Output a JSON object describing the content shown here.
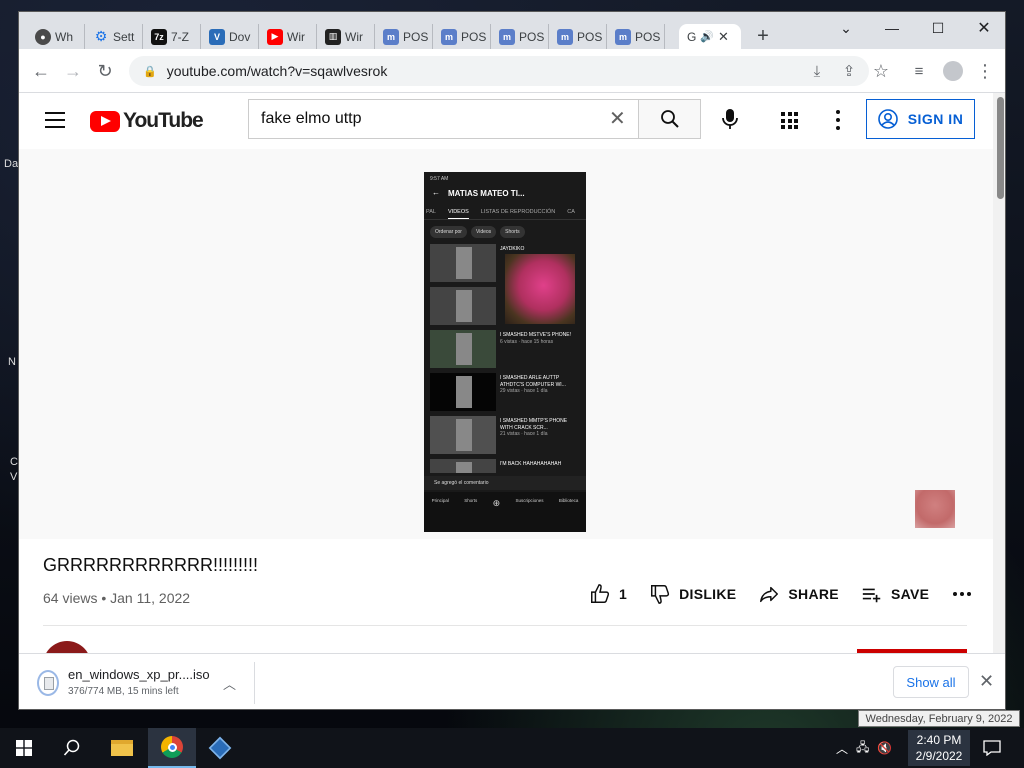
{
  "browser": {
    "tabs": [
      {
        "label": "Wh",
        "icon": "chrome-icon",
        "color": "#4a4a4a"
      },
      {
        "label": "Sett",
        "icon": "gear-icon",
        "color": "#1a73e8"
      },
      {
        "label": "7-Z",
        "icon": "7zip-icon",
        "color": "#111111"
      },
      {
        "label": "Dov",
        "icon": "virtualbox-icon",
        "color": "#2a6cb8"
      },
      {
        "label": "Wir",
        "icon": "youtube-icon",
        "color": "#ff0000"
      },
      {
        "label": "Wir",
        "icon": "archive-icon",
        "color": "#222222"
      },
      {
        "label": "POS",
        "icon": "m-icon",
        "color": "#5b7ec9"
      },
      {
        "label": "POS",
        "icon": "m-icon",
        "color": "#5b7ec9"
      },
      {
        "label": "POS",
        "icon": "m-icon",
        "color": "#5b7ec9"
      },
      {
        "label": "POS",
        "icon": "m-icon",
        "color": "#5b7ec9"
      },
      {
        "label": "POS",
        "icon": "m-icon",
        "color": "#5b7ec9"
      },
      {
        "label": "G",
        "icon": "audio-icon",
        "color": "#202124"
      }
    ],
    "url": "youtube.com/watch?v=sqawlvesrok"
  },
  "youtube": {
    "logo_text": "YouTube",
    "search_value": "fake elmo uttp",
    "sign_in": "SIGN IN",
    "accent": "#ff0000",
    "link_color": "#065fd4"
  },
  "phone": {
    "status_time": "9:57 AM",
    "channel_title": "MATIAS MATEO TI...",
    "tabs": [
      "PAL",
      "VIDEOS",
      "LISTAS DE REPRODUCCIÓN",
      "CA"
    ],
    "chips": [
      "Ordenar por",
      "Videos",
      "Shorts"
    ],
    "rows": [
      {
        "title": "JAYDKIKO",
        "sub": ""
      },
      {
        "title": "",
        "sub": ""
      },
      {
        "title": "I SMASHED MSTVE'S PHONE!",
        "sub": "6 vistas · hace 15 horas"
      },
      {
        "title": "I SMASHED ARLE AUTTP ATHDTC'S COMPUTER WI...",
        "sub": "29 vistas · hace 1 día"
      },
      {
        "title": "I SMASHED MMTP'S PHONE WITH CRACK SCR...",
        "sub": "21 vistas · hace 1 día"
      },
      {
        "title": "I'M BACK HAHAHAHAHAH",
        "sub": ""
      }
    ],
    "toast": "Se agregó el comentario",
    "nav": [
      "Principal",
      "Shorts",
      "",
      "Suscripciones",
      "Biblioteca"
    ]
  },
  "video": {
    "title": "GRRRRRRRRRRRR!!!!!!!!!",
    "meta": "64 views • Jan 11, 2022",
    "likes": "1",
    "dislike": "DISLIKE",
    "share": "SHARE",
    "save": "SAVE"
  },
  "download": {
    "filename": "en_windows_xp_pr....iso",
    "status": "376/774 MB, 15 mins left",
    "show_all": "Show all"
  },
  "taskbar": {
    "time": "2:40 PM",
    "date": "2/9/2022",
    "tooltip": "Wednesday, February 9, 2022"
  }
}
